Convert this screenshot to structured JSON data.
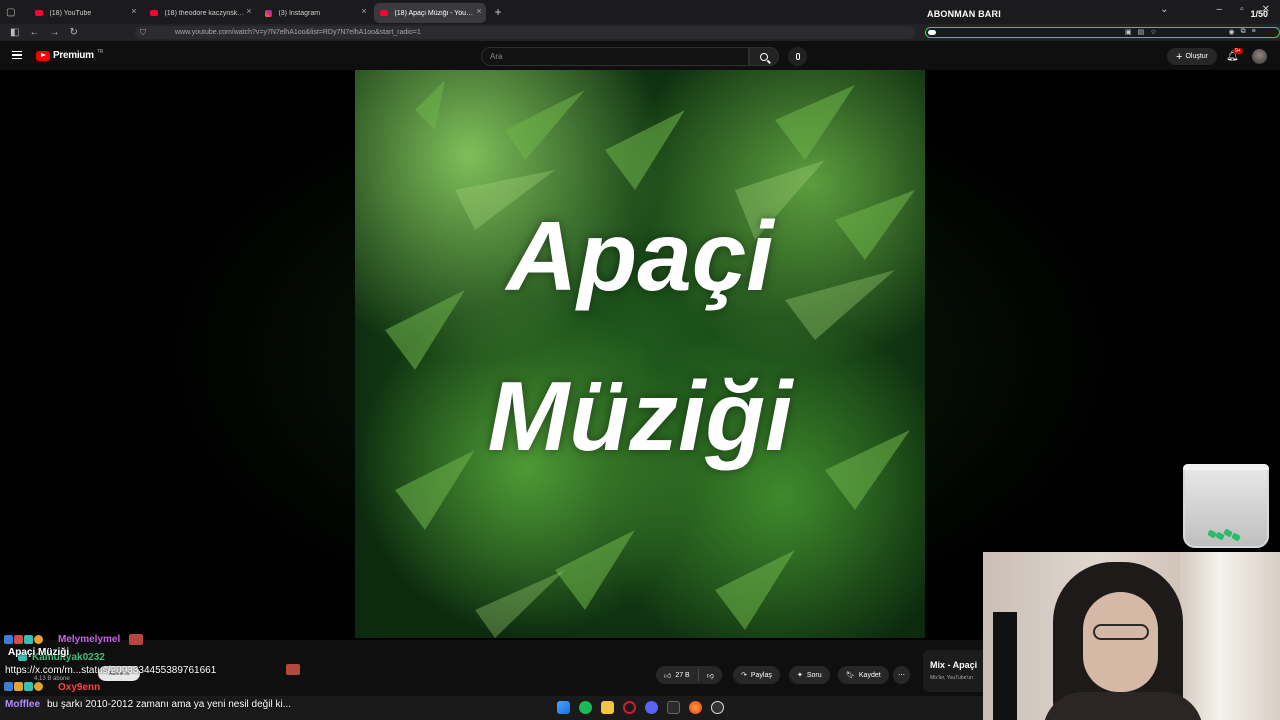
{
  "browser": {
    "tabs": [
      {
        "label": "(18) YouTube",
        "icon": "youtube-icon",
        "active": false
      },
      {
        "label": "(18) theodore kaczynski - YouTube",
        "icon": "youtube-icon",
        "active": false
      },
      {
        "label": "(3) Instagram",
        "icon": "instagram-icon",
        "active": false
      },
      {
        "label": "(18) Apaçi Müziği - YouTube",
        "icon": "youtube-icon",
        "active": true
      }
    ],
    "url": "www.youtube.com/watch?v=y7N7elhA1oo&list=RDy7N7elhA1oo&start_radio=1"
  },
  "overlay": {
    "abonman_title": "ABONMAN BARI",
    "abonman_count": "1/50",
    "abonman_progress": 0.02
  },
  "youtube": {
    "logo_text": "Premium",
    "logo_tm": "TR",
    "search_placeholder": "Ara",
    "create_label": "Oluştur",
    "bell_badge": "9+"
  },
  "video": {
    "art_line1": "Apaçi",
    "art_line2": "Müziği",
    "title": "Apaçi Müziği",
    "subscribers": "4,13 B abone",
    "likes": "27 B",
    "share_label": "Paylaş",
    "ask_label": "Soru",
    "save_label": "Kaydet"
  },
  "mix": {
    "title": "Mix - Apaçi",
    "subtitle": "Mix'ler, YouTube'un"
  },
  "chat": [
    {
      "user": "Melymelymel",
      "color": "#c864e6",
      "message": "Apaçi Müziği"
    },
    {
      "user": "Kamuityak0232",
      "color": "#3fbf7f",
      "message": "https://x.com/m...status/2093334455389761661"
    },
    {
      "user": "Oxy9enn",
      "color": "#ff4040",
      "message": ""
    },
    {
      "user": "Mofflee",
      "color": "#b48cff",
      "message": "bu şarkı 2010-2012 zamanı ama ya yeni nesil değil ki..."
    }
  ],
  "pill_label": "Abone ol"
}
